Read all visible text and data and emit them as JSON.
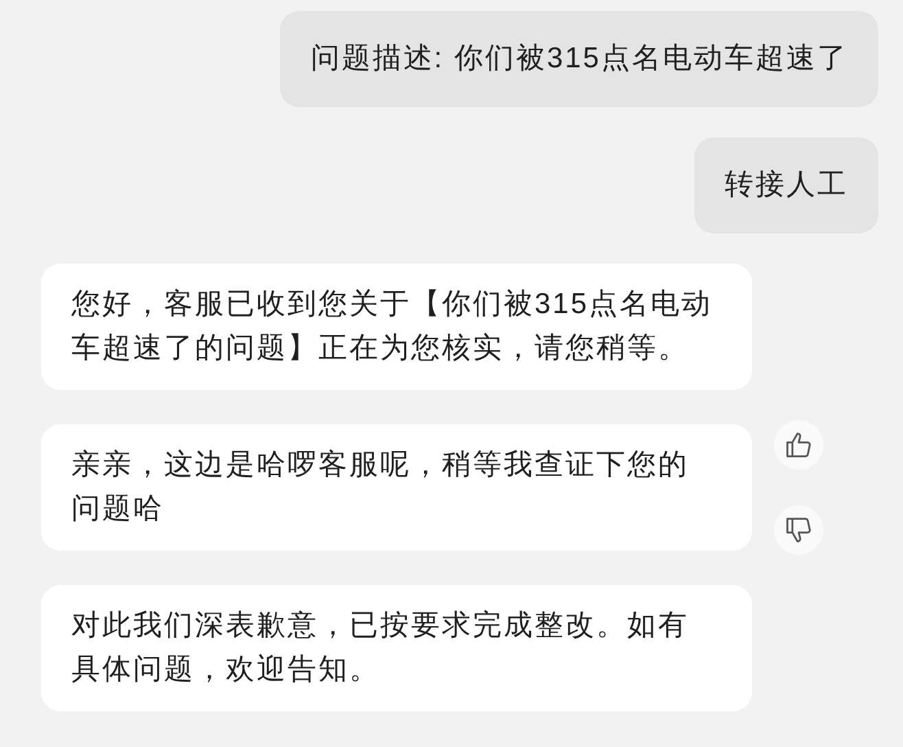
{
  "messages": [
    {
      "kind": "sent",
      "text": "问题描述: 你们被315点名电动车超速了",
      "feedback_buttons": false
    },
    {
      "kind": "sent",
      "text": "转接人工",
      "feedback_buttons": false
    },
    {
      "kind": "received",
      "text": "您好，客服已收到您关于【你们被315点名电动车超速了的问题】正在为您核实，请您稍等。",
      "feedback_buttons": false
    },
    {
      "kind": "received",
      "text": "亲亲，这边是哈啰客服呢，稍等我查证下您的问题哈",
      "feedback_buttons": true
    },
    {
      "kind": "received",
      "text": "对此我们深表歉意，已按要求完成整改。如有具体问题，欢迎告知。",
      "feedback_buttons": false
    }
  ]
}
